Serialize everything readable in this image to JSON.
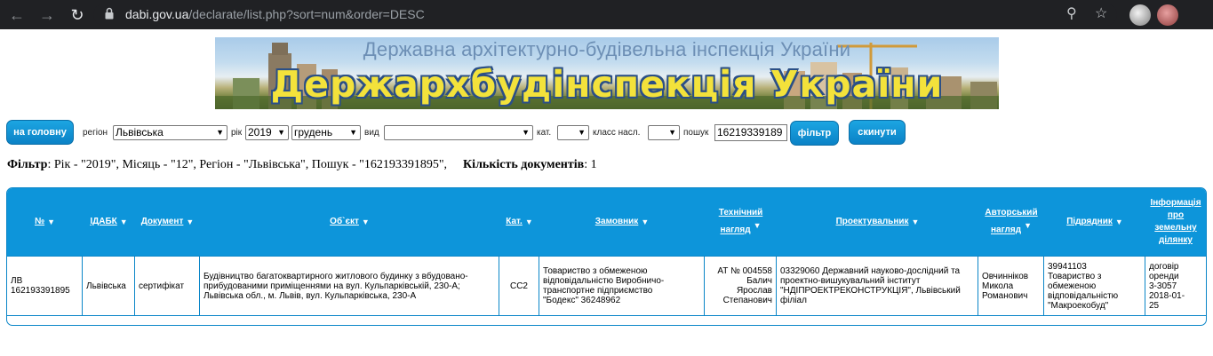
{
  "browser": {
    "url_host": "dabi.gov.ua",
    "url_path": "/declarate/list.php?sort=num&order=DESC"
  },
  "banner": {
    "subtitle": "Державна архітектурно-будівельна інспекція України",
    "title": "Держархбудінспекція України"
  },
  "filters": {
    "home_button": "на головну",
    "region_label": "регіон",
    "region_value": "Львівська",
    "year_label": "рік",
    "year_value": "2019",
    "month_value": "грудень",
    "type_label": "вид",
    "type_value": "",
    "category_label": "кат.",
    "category_value": "",
    "class_label": "класс насл.",
    "class_value": "",
    "search_label": "пошук",
    "search_value": "16219339189",
    "filter_button": "фільтр",
    "reset_button": "скинути"
  },
  "summary": {
    "filter_label": "Фільтр",
    "filter_text": ": Рік - \"2019\", Місяць - \"12\", Регіон - \"Львівська\", Пошук - \"162193391895\",",
    "count_label": "Кількість документів",
    "count_value": ": 1"
  },
  "table": {
    "headers": {
      "num": "№",
      "idabk": "ІДАБК",
      "document": "Документ",
      "object": "Об`єкт",
      "category": "Кат.",
      "customer": "Замовник",
      "tech_supervision_1": "Технічний",
      "tech_supervision_2": "нагляд",
      "designer": "Проектувальник",
      "author_supervision_1": "Авторський",
      "author_supervision_2": "нагляд",
      "contractor": "Підрядник",
      "land_info_1": "Інформація",
      "land_info_2": "про",
      "land_info_3": "земельну",
      "land_info_4": "ділянку"
    },
    "rows": [
      {
        "num_1": "ЛВ",
        "num_2": "162193391895",
        "idabk": "Львівська",
        "document": "сертифікат",
        "object_1": "Будівництво багатоквартирного житлового будинку з вбудовано-",
        "object_2": "прибудованими приміщеннями на вул. Кульпарківській, 230-А;",
        "object_3": "Львівська обл., м. Львів, вул. Кульпарківська, 230-А",
        "category": "СС2",
        "customer_1": "Товариство з обмеженою",
        "customer_2": "відповідальністю Виробничо-",
        "customer_3": "транспортне підприємство",
        "customer_4": "\"Бодекс\" 36248962",
        "tech_1": "АТ № 004558",
        "tech_2": "Балич",
        "tech_3": "Ярослав",
        "tech_4": "Степанович",
        "designer_1": "03329060 Державний науково-дослідний та",
        "designer_2": "проектно-вишукувальний інститут",
        "designer_3": "\"НДІПРОЕКТРЕКОНСТРУКЦІЯ\", Львівський",
        "designer_4": "філіал",
        "author_1": "Овчинніков",
        "author_2": "Микола",
        "author_3": "Романович",
        "contractor_1": "39941103",
        "contractor_2": "Товариство з",
        "contractor_3": "обмеженою",
        "contractor_4": "відповідальністю",
        "contractor_5": "\"Макроекобуд\"",
        "land_1": "договір",
        "land_2": "оренди",
        "land_3": "3-3057",
        "land_4": "2018-01-",
        "land_5": "25"
      }
    ]
  }
}
